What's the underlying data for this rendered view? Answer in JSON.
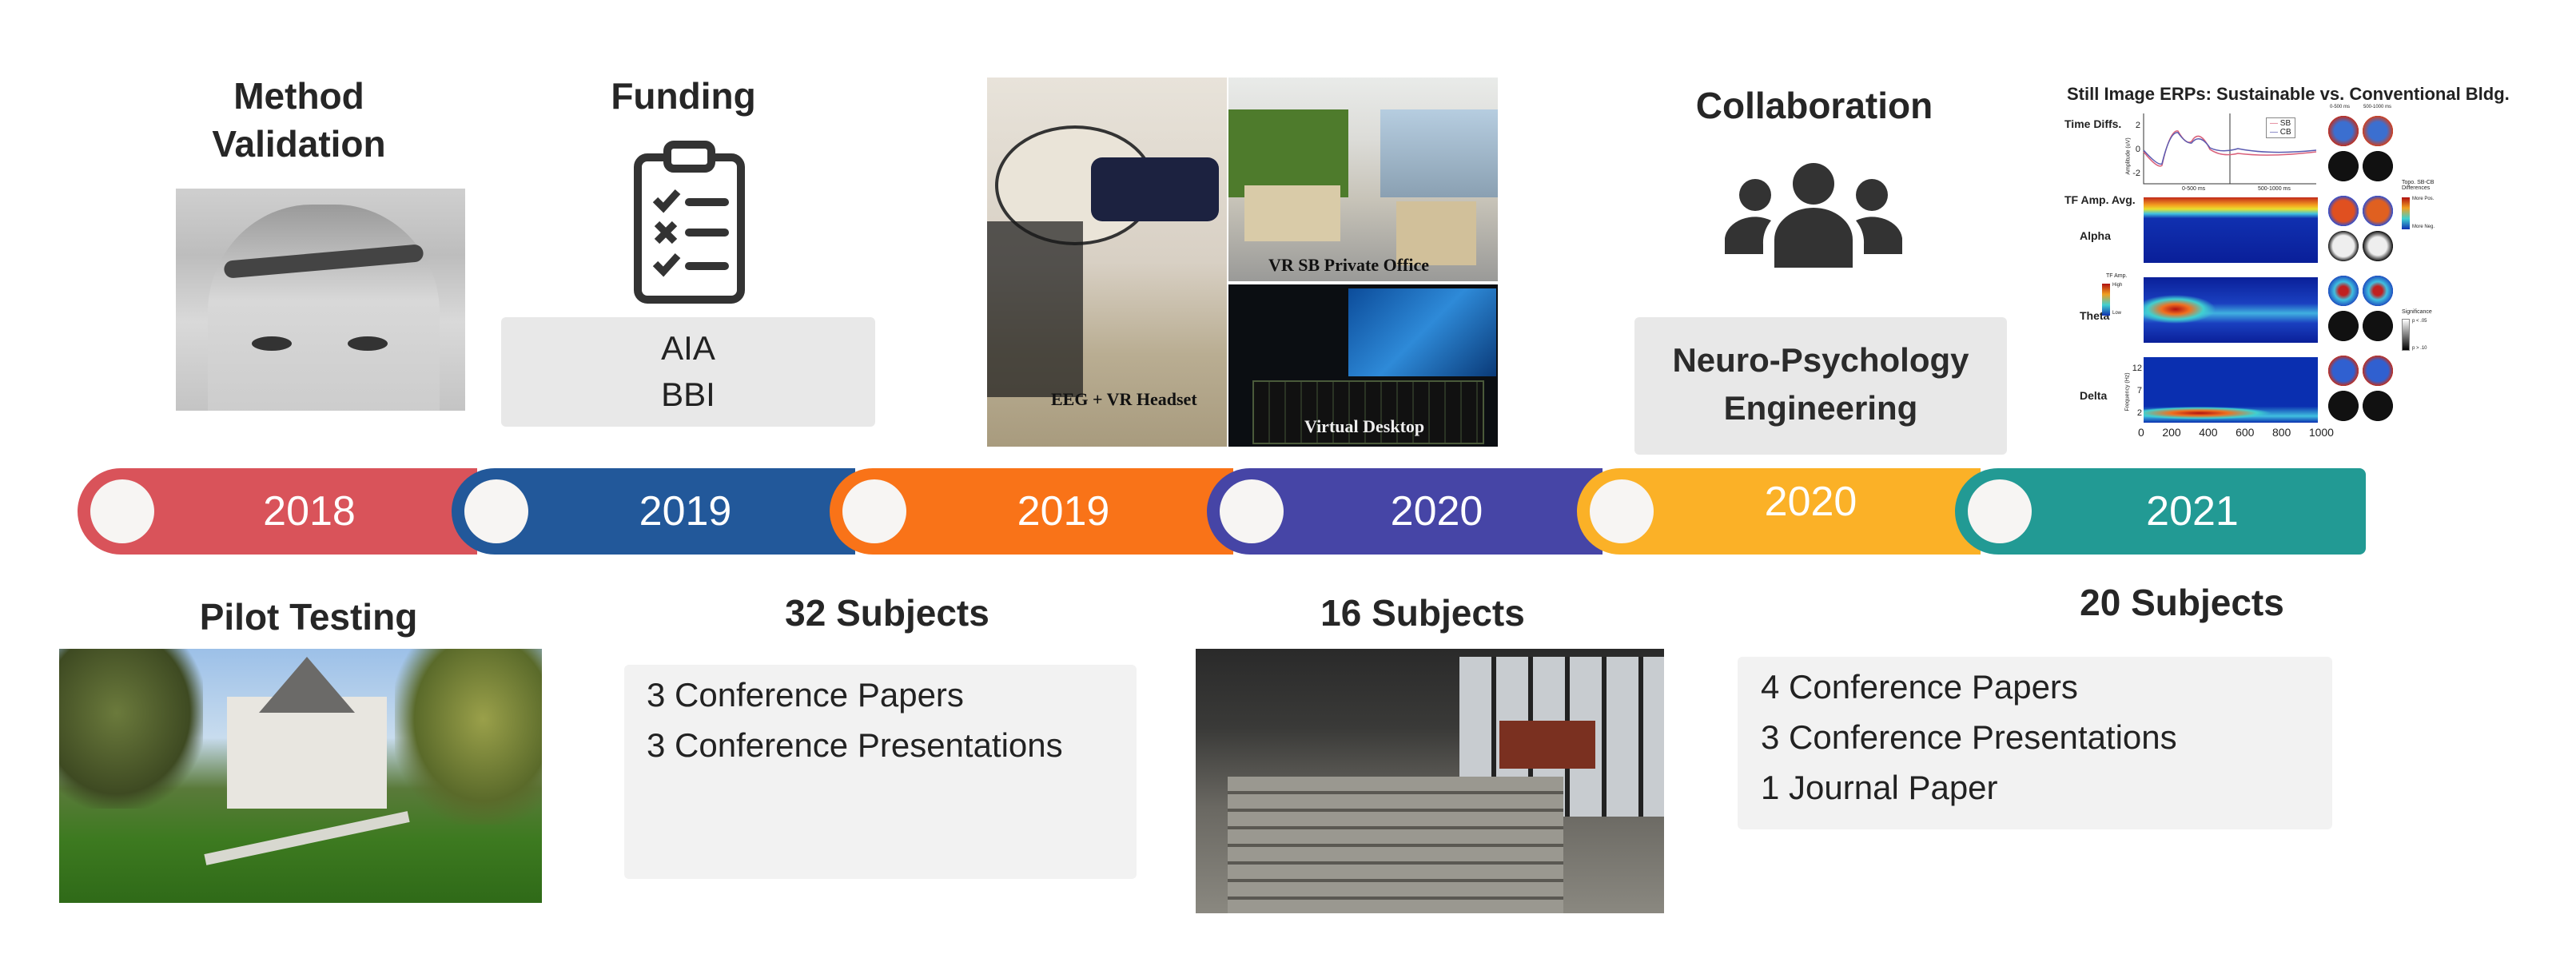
{
  "top": {
    "method": {
      "title_line1": "Method",
      "title_line2": "Validation"
    },
    "funding": {
      "title": "Funding",
      "items": [
        "AIA",
        "BBI"
      ],
      "icon": "clipboard-checklist-icon"
    },
    "vr_images": {
      "captions": [
        "EEG + VR Headset",
        "VR SB Private Office",
        "Virtual Desktop"
      ]
    },
    "collaboration": {
      "title": "Collaboration",
      "items": [
        "Neuro-Psychology",
        "Engineering"
      ],
      "icon": "people-group-icon"
    },
    "erp_figure": {
      "title": "Still Image ERPs: Sustainable vs. Conventional Bldg.",
      "row_labels": [
        "Time Diffs.",
        "TF Amp. Avg.",
        "Alpha",
        "Theta",
        "Delta"
      ],
      "legend": [
        "SB",
        "CB"
      ],
      "x_ticks": [
        "0",
        "200",
        "400",
        "600",
        "800",
        "1000"
      ],
      "y_ticks_amp": [
        "2",
        "0",
        "-2"
      ],
      "y_ticks_freq": [
        "12",
        "7",
        "2"
      ],
      "y_label_amp": "Amplitude (uV)",
      "y_label_freq": "Frequency (Hz)",
      "window_labels": [
        "0-500 ms",
        "500-1000 ms"
      ],
      "colorbar_tf": {
        "title": "TF Amp.",
        "high": "High",
        "low": "Low"
      },
      "colorbar_topo": {
        "title": "Topo. SB-CB Differences",
        "high": "More Pos.",
        "low": "More Neg."
      },
      "colorbar_sig": {
        "title": "Significance",
        "high": "p < .05",
        "low": "p > .10"
      },
      "series_colors": {
        "SB": "#d9607a",
        "CB": "#5a5ab0"
      }
    }
  },
  "timeline": [
    {
      "year": "2018",
      "color": "#d9535a"
    },
    {
      "year": "2019",
      "color": "#22589a"
    },
    {
      "year": "2019",
      "color": "#f97318"
    },
    {
      "year": "2020",
      "color": "#4645a6"
    },
    {
      "year": "2020",
      "color": "#fbb127"
    },
    {
      "year": "2021",
      "color": "#229a94"
    }
  ],
  "bottom": {
    "pilot": {
      "title": "Pilot Testing"
    },
    "s32": {
      "title": "32 Subjects",
      "items": [
        "3 Conference Papers",
        "3 Conference Presentations"
      ]
    },
    "s16": {
      "title": "16 Subjects"
    },
    "s20": {
      "title": "20 Subjects",
      "items": [
        "4 Conference Papers",
        "3 Conference Presentations",
        "1 Journal Paper"
      ]
    }
  }
}
